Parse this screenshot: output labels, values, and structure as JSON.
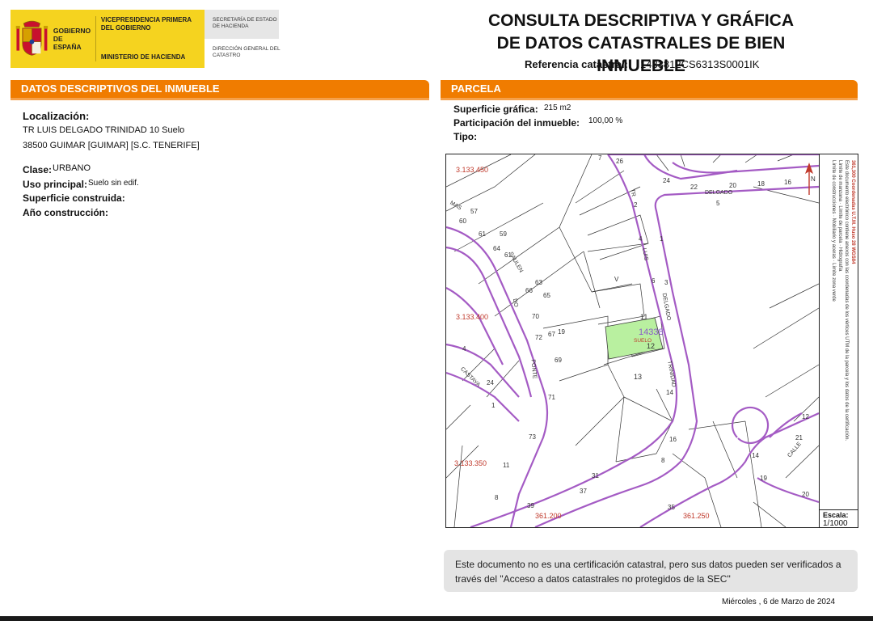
{
  "header": {
    "gob_name": "GOBIERNO DE ESPAÑA",
    "vicepresidencia": "VICEPRESIDENCIA PRIMERA DEL GOBIERNO",
    "ministerio": "MINISTERIO DE HACIENDA",
    "secretaria": "SECRETARÍA DE ESTADO DE HACIENDA",
    "direccion": "DIRECCIÓN GENERAL DEL CATASTRO",
    "title_line1": "CONSULTA DESCRIPTIVA Y GRÁFICA",
    "title_line2": "DE DATOS CATASTRALES DE BIEN INMUEBLE",
    "ref_label": "Referencia catastral:",
    "ref_value": "1433812CS6313S0001IK"
  },
  "left_section": {
    "bar_label": "DATOS DESCRIPTIVOS DEL INMUEBLE",
    "localizacion_label": "Localización:",
    "address_line1": "TR LUIS DELGADO TRINIDAD 10 Suelo",
    "address_line2": "38500 GUIMAR [GUIMAR] [S.C. TENERIFE]",
    "clase_label": "Clase:",
    "clase_value": "URBANO",
    "uso_label": "Uso principal:",
    "uso_value": "Suelo sin edif.",
    "superficie_label": "Superficie construida:",
    "anio_label": "Año construcción:"
  },
  "right_section": {
    "bar_label": "PARCELA",
    "superficie_label": "Superficie gráfica:",
    "superficie_value": "215 m2",
    "participacion_label": "Participación del inmueble:",
    "participacion_value": "100,00 %",
    "tipo_label": "Tipo:"
  },
  "map": {
    "coord_labels": [
      "3.133.450",
      "3.133.400",
      "3.133.350",
      "361.200",
      "361.250"
    ],
    "street_labels": [
      "DELGADO",
      "SAULEN",
      "DO",
      "PONTE",
      "CALLE",
      "LUIS",
      "DELGADO",
      "TRINIDAD",
      "TR",
      "CASTAYA",
      "MAS"
    ],
    "parcel_numbers": [
      "26",
      "24",
      "22",
      "20",
      "18",
      "16",
      "5",
      "57",
      "60",
      "61",
      "59",
      "64",
      "61",
      "63",
      "65",
      "66",
      "70",
      "72",
      "67",
      "69",
      "71",
      "73",
      "11",
      "8",
      "39",
      "31",
      "37",
      "35",
      "19",
      "11",
      "12",
      "13",
      "14",
      "16",
      "19",
      "20",
      "21",
      "12",
      "14",
      "8",
      "7",
      "3",
      "1",
      "2",
      "4",
      "6",
      "V",
      "4",
      "24",
      "1"
    ],
    "parcel_id": "14338",
    "parcel_tag": "SUELO",
    "north_label": "N",
    "legend_lines": [
      "361,300 Coordenadas U.T.M. Huso 28 WGS84",
      "Este documento electrónico contiene anexos con las coordenadas de los vértices UTM de la parcela y los datos de la certificación.",
      "Límite de manzana",
      "Límite de parcela",
      "Hidrografía",
      "Límite de construcciones",
      "Mobiliario y aceras",
      "Límite zona verde"
    ],
    "scale_label": "Escala:",
    "scale_value": "1/1000",
    "colors": {
      "street": "#a45bc4",
      "parcel_fill": "#b9f0a0",
      "parcel_id": "#8a5cc8",
      "coord": "#c0392b"
    }
  },
  "notice": {
    "line1": "Este documento no es una certificación catastral, pero sus datos pueden ser verificados a",
    "line2": "través del \"Acceso a datos catastrales no protegidos de la SEC\""
  },
  "footer": {
    "date": "Miércoles , 6 de Marzo de 2024"
  },
  "colors": {
    "accent": "#f07c00",
    "gob_yellow": "#f5d31f"
  }
}
